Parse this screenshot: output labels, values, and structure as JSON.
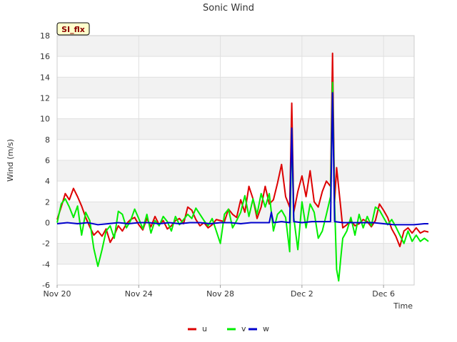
{
  "chart_data": {
    "type": "line",
    "title": "Sonic Wind",
    "xlabel": "Time",
    "ylabel": "Wind (m/s)",
    "badge": "SI_flx",
    "xlim": [
      0,
      17.5
    ],
    "ylim": [
      -6,
      18
    ],
    "yticks": [
      -6,
      -4,
      -2,
      0,
      2,
      4,
      6,
      8,
      10,
      12,
      14,
      16,
      18
    ],
    "xticks": [
      {
        "value": 0,
        "label": "Nov 20"
      },
      {
        "value": 4,
        "label": "Nov 24"
      },
      {
        "value": 8,
        "label": "Nov 28"
      },
      {
        "value": 12,
        "label": "Dec 2"
      },
      {
        "value": 16,
        "label": "Dec 6"
      }
    ],
    "grid": true,
    "legend_position": "bottom",
    "series": [
      {
        "name": "u",
        "color": "#dd0000",
        "points": [
          [
            0.0,
            0.3
          ],
          [
            0.2,
            1.5
          ],
          [
            0.4,
            2.8
          ],
          [
            0.6,
            2.2
          ],
          [
            0.8,
            3.3
          ],
          [
            1.0,
            2.5
          ],
          [
            1.2,
            1.6
          ],
          [
            1.4,
            0.5
          ],
          [
            1.6,
            -0.4
          ],
          [
            1.8,
            -1.2
          ],
          [
            2.0,
            -0.8
          ],
          [
            2.2,
            -1.3
          ],
          [
            2.4,
            -0.6
          ],
          [
            2.6,
            -1.9
          ],
          [
            2.8,
            -1.2
          ],
          [
            3.0,
            -0.3
          ],
          [
            3.2,
            -0.8
          ],
          [
            3.4,
            -0.1
          ],
          [
            3.6,
            0.3
          ],
          [
            3.8,
            0.5
          ],
          [
            4.0,
            -0.2
          ],
          [
            4.2,
            -0.7
          ],
          [
            4.4,
            0.4
          ],
          [
            4.6,
            -0.4
          ],
          [
            4.8,
            0.6
          ],
          [
            5.0,
            -0.2
          ],
          [
            5.2,
            0.2
          ],
          [
            5.4,
            -0.6
          ],
          [
            5.6,
            -0.3
          ],
          [
            5.8,
            0.2
          ],
          [
            6.0,
            0.4
          ],
          [
            6.2,
            -0.1
          ],
          [
            6.4,
            1.5
          ],
          [
            6.6,
            1.2
          ],
          [
            6.8,
            0.3
          ],
          [
            7.0,
            -0.3
          ],
          [
            7.2,
            0.0
          ],
          [
            7.4,
            -0.5
          ],
          [
            7.6,
            -0.2
          ],
          [
            7.8,
            0.3
          ],
          [
            8.0,
            0.2
          ],
          [
            8.2,
            0.1
          ],
          [
            8.4,
            1.3
          ],
          [
            8.6,
            0.8
          ],
          [
            8.8,
            0.5
          ],
          [
            9.0,
            2.2
          ],
          [
            9.2,
            1.0
          ],
          [
            9.4,
            3.5
          ],
          [
            9.6,
            2.3
          ],
          [
            9.8,
            0.4
          ],
          [
            10.0,
            1.5
          ],
          [
            10.2,
            3.5
          ],
          [
            10.4,
            1.8
          ],
          [
            10.6,
            2.2
          ],
          [
            10.8,
            3.8
          ],
          [
            11.0,
            5.6
          ],
          [
            11.2,
            2.5
          ],
          [
            11.4,
            1.5
          ],
          [
            11.5,
            11.5
          ],
          [
            11.6,
            1.0
          ],
          [
            11.8,
            3.0
          ],
          [
            12.0,
            4.5
          ],
          [
            12.2,
            2.5
          ],
          [
            12.4,
            5.0
          ],
          [
            12.6,
            2.0
          ],
          [
            12.8,
            1.5
          ],
          [
            13.0,
            3.0
          ],
          [
            13.2,
            4.0
          ],
          [
            13.4,
            3.5
          ],
          [
            13.5,
            16.3
          ],
          [
            13.6,
            2.0
          ],
          [
            13.7,
            5.3
          ],
          [
            13.9,
            1.5
          ],
          [
            14.0,
            -0.5
          ],
          [
            14.2,
            -0.2
          ],
          [
            14.4,
            0.2
          ],
          [
            14.6,
            -0.3
          ],
          [
            14.8,
            -0.1
          ],
          [
            15.0,
            0.3
          ],
          [
            15.2,
            0.1
          ],
          [
            15.4,
            -0.4
          ],
          [
            15.6,
            0.2
          ],
          [
            15.8,
            1.8
          ],
          [
            16.0,
            1.2
          ],
          [
            16.2,
            0.5
          ],
          [
            16.4,
            -0.6
          ],
          [
            16.6,
            -1.3
          ],
          [
            16.8,
            -2.3
          ],
          [
            17.0,
            -0.8
          ],
          [
            17.2,
            -0.5
          ],
          [
            17.4,
            -1.0
          ],
          [
            17.6,
            -0.5
          ],
          [
            17.8,
            -1.0
          ],
          [
            18.0,
            -0.8
          ],
          [
            18.2,
            -0.9
          ]
        ]
      },
      {
        "name": "v",
        "color": "#00ee00",
        "points": [
          [
            0.0,
            0.0
          ],
          [
            0.2,
            1.8
          ],
          [
            0.4,
            2.3
          ],
          [
            0.6,
            1.5
          ],
          [
            0.8,
            0.5
          ],
          [
            1.0,
            1.6
          ],
          [
            1.2,
            -1.2
          ],
          [
            1.4,
            1.0
          ],
          [
            1.6,
            0.2
          ],
          [
            1.8,
            -2.5
          ],
          [
            2.0,
            -4.2
          ],
          [
            2.2,
            -2.6
          ],
          [
            2.4,
            -0.8
          ],
          [
            2.6,
            -0.3
          ],
          [
            2.8,
            -1.5
          ],
          [
            3.0,
            1.1
          ],
          [
            3.2,
            0.8
          ],
          [
            3.4,
            -0.5
          ],
          [
            3.6,
            0.2
          ],
          [
            3.8,
            1.3
          ],
          [
            4.0,
            0.4
          ],
          [
            4.2,
            -0.6
          ],
          [
            4.4,
            0.8
          ],
          [
            4.6,
            -1.0
          ],
          [
            4.8,
            0.2
          ],
          [
            5.0,
            -0.3
          ],
          [
            5.2,
            0.6
          ],
          [
            5.4,
            0.1
          ],
          [
            5.6,
            -0.8
          ],
          [
            5.8,
            0.6
          ],
          [
            6.0,
            -0.2
          ],
          [
            6.2,
            0.3
          ],
          [
            6.4,
            0.8
          ],
          [
            6.6,
            0.4
          ],
          [
            6.8,
            1.4
          ],
          [
            7.0,
            0.8
          ],
          [
            7.2,
            0.2
          ],
          [
            7.4,
            -0.3
          ],
          [
            7.6,
            0.4
          ],
          [
            7.8,
            -0.8
          ],
          [
            8.0,
            -2.0
          ],
          [
            8.2,
            0.8
          ],
          [
            8.4,
            1.3
          ],
          [
            8.6,
            -0.5
          ],
          [
            8.8,
            0.2
          ],
          [
            9.0,
            1.0
          ],
          [
            9.2,
            2.6
          ],
          [
            9.4,
            0.6
          ],
          [
            9.6,
            2.3
          ],
          [
            9.8,
            0.8
          ],
          [
            10.0,
            2.8
          ],
          [
            10.2,
            1.5
          ],
          [
            10.4,
            2.8
          ],
          [
            10.6,
            -0.8
          ],
          [
            10.8,
            0.8
          ],
          [
            11.0,
            1.2
          ],
          [
            11.2,
            0.5
          ],
          [
            11.4,
            -2.8
          ],
          [
            11.5,
            9.0
          ],
          [
            11.6,
            0.5
          ],
          [
            11.8,
            -2.6
          ],
          [
            12.0,
            2.0
          ],
          [
            12.2,
            -0.5
          ],
          [
            12.4,
            1.8
          ],
          [
            12.6,
            1.0
          ],
          [
            12.8,
            -1.5
          ],
          [
            13.0,
            -0.8
          ],
          [
            13.2,
            0.8
          ],
          [
            13.4,
            2.5
          ],
          [
            13.5,
            13.5
          ],
          [
            13.6,
            1.8
          ],
          [
            13.7,
            -4.5
          ],
          [
            13.8,
            -5.6
          ],
          [
            13.9,
            -3.5
          ],
          [
            14.0,
            -1.5
          ],
          [
            14.2,
            -0.8
          ],
          [
            14.4,
            0.5
          ],
          [
            14.6,
            -1.2
          ],
          [
            14.8,
            0.8
          ],
          [
            15.0,
            -0.5
          ],
          [
            15.2,
            0.6
          ],
          [
            15.4,
            -0.3
          ],
          [
            15.6,
            1.5
          ],
          [
            15.8,
            1.2
          ],
          [
            16.0,
            0.5
          ],
          [
            16.2,
            -0.2
          ],
          [
            16.4,
            0.3
          ],
          [
            16.6,
            -0.4
          ],
          [
            16.8,
            -1.2
          ],
          [
            17.0,
            -2.0
          ],
          [
            17.2,
            -0.8
          ],
          [
            17.4,
            -1.8
          ],
          [
            17.6,
            -1.2
          ],
          [
            17.8,
            -1.8
          ],
          [
            18.0,
            -1.5
          ],
          [
            18.2,
            -1.8
          ]
        ]
      },
      {
        "name": "w",
        "color": "#0000cc",
        "points": [
          [
            0.0,
            -0.1
          ],
          [
            0.5,
            0.0
          ],
          [
            1.0,
            -0.1
          ],
          [
            1.5,
            0.0
          ],
          [
            2.0,
            -0.2
          ],
          [
            2.5,
            -0.1
          ],
          [
            3.0,
            0.0
          ],
          [
            3.5,
            -0.1
          ],
          [
            4.0,
            0.0
          ],
          [
            4.5,
            0.0
          ],
          [
            5.0,
            -0.1
          ],
          [
            5.5,
            0.0
          ],
          [
            6.0,
            -0.1
          ],
          [
            6.5,
            0.0
          ],
          [
            7.0,
            0.0
          ],
          [
            7.5,
            -0.1
          ],
          [
            8.0,
            0.0
          ],
          [
            8.5,
            0.0
          ],
          [
            9.0,
            -0.1
          ],
          [
            9.5,
            0.0
          ],
          [
            10.0,
            0.0
          ],
          [
            10.4,
            0.0
          ],
          [
            10.5,
            1.0
          ],
          [
            10.6,
            0.0
          ],
          [
            11.0,
            0.1
          ],
          [
            11.4,
            0.0
          ],
          [
            11.5,
            9.1
          ],
          [
            11.6,
            0.1
          ],
          [
            12.0,
            0.0
          ],
          [
            12.5,
            0.1
          ],
          [
            13.0,
            0.1
          ],
          [
            13.4,
            0.1
          ],
          [
            13.5,
            12.5
          ],
          [
            13.6,
            0.1
          ],
          [
            14.0,
            0.0
          ],
          [
            14.5,
            0.0
          ],
          [
            15.0,
            0.0
          ],
          [
            15.5,
            0.0
          ],
          [
            16.0,
            -0.1
          ],
          [
            16.5,
            -0.2
          ],
          [
            17.0,
            -0.2
          ],
          [
            17.5,
            -0.2
          ],
          [
            18.0,
            -0.1
          ],
          [
            18.2,
            -0.1
          ]
        ]
      }
    ]
  }
}
